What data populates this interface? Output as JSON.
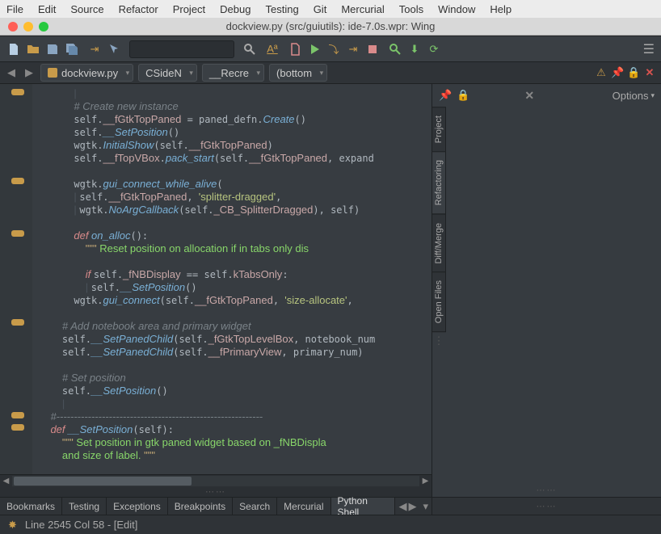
{
  "menubar": [
    "File",
    "Edit",
    "Source",
    "Refactor",
    "Project",
    "Debug",
    "Testing",
    "Git",
    "Mercurial",
    "Tools",
    "Window",
    "Help"
  ],
  "window_title": "dockview.py (src/guiutils): ide-7.0s.wpr: Wing",
  "tabrow": {
    "file": "dockview.py",
    "scope1": "CSideN",
    "scope2": "__Recre",
    "scope3": "(bottom"
  },
  "right_panel": {
    "options_label": "Options",
    "vtabs": [
      "Project",
      "Refactoring",
      "Diff/Merge",
      "Open Files"
    ]
  },
  "code_lines": [
    {
      "indent": 3,
      "segs": [
        {
          "t": "|",
          "cls": "indent-g"
        }
      ]
    },
    {
      "indent": 3,
      "segs": [
        {
          "t": "# Create new instance",
          "cls": "c"
        }
      ]
    },
    {
      "indent": 3,
      "segs": [
        {
          "t": "self."
        },
        {
          "t": "__fGtkTopPaned",
          "cls": "sf"
        },
        {
          "t": " = paned_defn."
        },
        {
          "t": "Create",
          "cls": "f"
        },
        {
          "t": "()"
        }
      ]
    },
    {
      "indent": 3,
      "segs": [
        {
          "t": "self."
        },
        {
          "t": "__SetPosition",
          "cls": "f"
        },
        {
          "t": "()"
        }
      ]
    },
    {
      "indent": 3,
      "segs": [
        {
          "t": "wgtk."
        },
        {
          "t": "InitialShow",
          "cls": "f"
        },
        {
          "t": "(self."
        },
        {
          "t": "__fGtkTopPaned",
          "cls": "sf"
        },
        {
          "t": ")"
        }
      ]
    },
    {
      "indent": 3,
      "segs": [
        {
          "t": "self."
        },
        {
          "t": "__fTopVBox",
          "cls": "sf"
        },
        {
          "t": "."
        },
        {
          "t": "pack_start",
          "cls": "f"
        },
        {
          "t": "(self."
        },
        {
          "t": "__fGtkTopPaned",
          "cls": "sf"
        },
        {
          "t": ", expand"
        }
      ]
    },
    {
      "indent": 3,
      "segs": [
        {
          "t": ""
        }
      ]
    },
    {
      "indent": 3,
      "segs": [
        {
          "t": "wgtk."
        },
        {
          "t": "gui_connect_while_alive",
          "cls": "f"
        },
        {
          "t": "("
        }
      ]
    },
    {
      "indent": 3,
      "segs": [
        {
          "t": "| ",
          "cls": "indent-g"
        },
        {
          "t": "self."
        },
        {
          "t": "__fGtkTopPaned",
          "cls": "sf"
        },
        {
          "t": ", "
        },
        {
          "t": "'splitter-dragged'",
          "cls": "s"
        },
        {
          "t": ","
        }
      ]
    },
    {
      "indent": 3,
      "segs": [
        {
          "t": "| ",
          "cls": "indent-g"
        },
        {
          "t": "wgtk."
        },
        {
          "t": "NoArgCallback",
          "cls": "f"
        },
        {
          "t": "(self."
        },
        {
          "t": "_CB_SplitterDragged",
          "cls": "sf"
        },
        {
          "t": "), self)"
        }
      ]
    },
    {
      "indent": 3,
      "segs": [
        {
          "t": ""
        }
      ]
    },
    {
      "indent": 3,
      "segs": [
        {
          "t": "def ",
          "cls": "k"
        },
        {
          "t": "on_alloc",
          "cls": "f"
        },
        {
          "t": "():"
        }
      ]
    },
    {
      "indent": 4,
      "segs": [
        {
          "t": "\"\"\"",
          "cls": "ds"
        },
        {
          "t": " Reset position on allocation if in tabs only dis",
          "cls": "hl-comment"
        }
      ]
    },
    {
      "indent": 4,
      "segs": [
        {
          "t": ""
        }
      ]
    },
    {
      "indent": 4,
      "segs": [
        {
          "t": "if ",
          "cls": "k"
        },
        {
          "t": "self."
        },
        {
          "t": "_fNBDisplay",
          "cls": "sf"
        },
        {
          "t": " == self."
        },
        {
          "t": "kTabsOnly",
          "cls": "sf"
        },
        {
          "t": ":"
        }
      ]
    },
    {
      "indent": 4,
      "segs": [
        {
          "t": "| ",
          "cls": "indent-g"
        },
        {
          "t": "self."
        },
        {
          "t": "__SetPosition",
          "cls": "f"
        },
        {
          "t": "()"
        }
      ]
    },
    {
      "indent": 3,
      "segs": [
        {
          "t": "wgtk."
        },
        {
          "t": "gui_connect",
          "cls": "f"
        },
        {
          "t": "(self."
        },
        {
          "t": "__fGtkTopPaned",
          "cls": "sf"
        },
        {
          "t": ", "
        },
        {
          "t": "'size-allocate'",
          "cls": "s"
        },
        {
          "t": ","
        }
      ]
    },
    {
      "indent": 2,
      "segs": [
        {
          "t": ""
        }
      ]
    },
    {
      "indent": 2,
      "segs": [
        {
          "t": "# Add notebook area and primary widget",
          "cls": "c"
        }
      ]
    },
    {
      "indent": 2,
      "segs": [
        {
          "t": "self."
        },
        {
          "t": "__SetPanedChild",
          "cls": "f"
        },
        {
          "t": "(self."
        },
        {
          "t": "_fGtkTopLevelBox",
          "cls": "sf"
        },
        {
          "t": ", notebook_num"
        }
      ]
    },
    {
      "indent": 2,
      "segs": [
        {
          "t": "self."
        },
        {
          "t": "__SetPanedChild",
          "cls": "f"
        },
        {
          "t": "(self."
        },
        {
          "t": "__fPrimaryView",
          "cls": "sf"
        },
        {
          "t": ", primary_num)"
        }
      ]
    },
    {
      "indent": 2,
      "segs": [
        {
          "t": ""
        }
      ]
    },
    {
      "indent": 2,
      "segs": [
        {
          "t": "# Set position",
          "cls": "c"
        }
      ]
    },
    {
      "indent": 2,
      "segs": [
        {
          "t": "self."
        },
        {
          "t": "__SetPosition",
          "cls": "f"
        },
        {
          "t": "()"
        }
      ]
    },
    {
      "indent": 2,
      "segs": [
        {
          "t": "|",
          "cls": "indent-g"
        }
      ]
    },
    {
      "indent": 1,
      "segs": [
        {
          "t": "#-----------------------------------------------------------",
          "cls": "c"
        }
      ]
    },
    {
      "indent": 1,
      "segs": [
        {
          "t": "def ",
          "cls": "k"
        },
        {
          "t": "__SetPosition",
          "cls": "f"
        },
        {
          "t": "(self):"
        }
      ]
    },
    {
      "indent": 2,
      "segs": [
        {
          "t": "\"\"\"",
          "cls": "ds"
        },
        {
          "t": " Set position in gtk paned widget based on _fNBDispla",
          "cls": "hl-comment"
        }
      ]
    },
    {
      "indent": 2,
      "segs": [
        {
          "t": "and size of label. ",
          "cls": "hl-comment"
        },
        {
          "t": "\"\"\"",
          "cls": "ds"
        }
      ]
    },
    {
      "indent": 2,
      "segs": [
        {
          "t": ""
        }
      ]
    }
  ],
  "fold_marks": [
    0,
    110,
    175,
    285,
    400,
    415
  ],
  "bottom_tabs": {
    "items": [
      "Bookmarks",
      "Testing",
      "Exceptions",
      "Breakpoints",
      "Search",
      "Mercurial",
      "Python Shell"
    ],
    "active_index": 6
  },
  "status": "Line 2545 Col 58 - [Edit]"
}
